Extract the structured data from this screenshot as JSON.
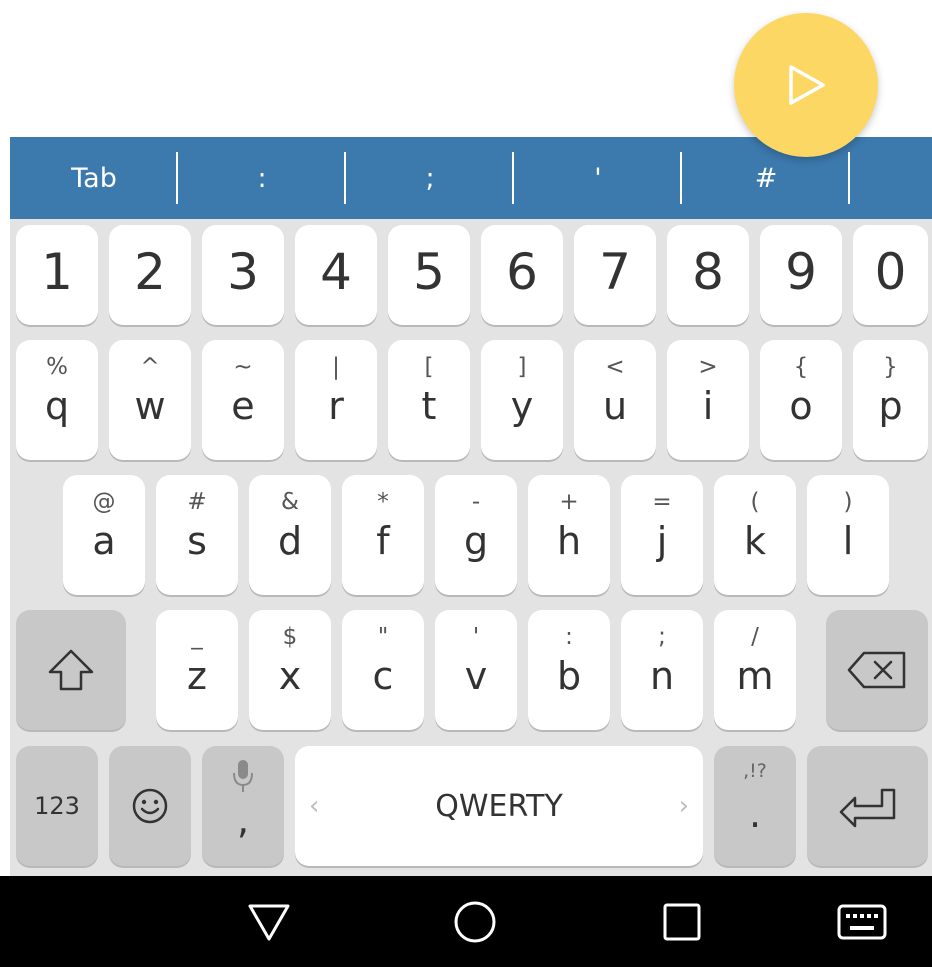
{
  "extra_row": {
    "keys": [
      "Tab",
      ":",
      ";",
      "'",
      "#",
      "("
    ]
  },
  "keyboard": {
    "numbers": [
      "1",
      "2",
      "3",
      "4",
      "5",
      "6",
      "7",
      "8",
      "9",
      "0"
    ],
    "row1": [
      {
        "main": "q",
        "sym": "%"
      },
      {
        "main": "w",
        "sym": "^"
      },
      {
        "main": "e",
        "sym": "~"
      },
      {
        "main": "r",
        "sym": "|"
      },
      {
        "main": "t",
        "sym": "["
      },
      {
        "main": "y",
        "sym": "]"
      },
      {
        "main": "u",
        "sym": "<"
      },
      {
        "main": "i",
        "sym": ">"
      },
      {
        "main": "o",
        "sym": "{"
      },
      {
        "main": "p",
        "sym": "}"
      }
    ],
    "row2": [
      {
        "main": "a",
        "sym": "@"
      },
      {
        "main": "s",
        "sym": "#"
      },
      {
        "main": "d",
        "sym": "&"
      },
      {
        "main": "f",
        "sym": "*"
      },
      {
        "main": "g",
        "sym": "-"
      },
      {
        "main": "h",
        "sym": "+"
      },
      {
        "main": "j",
        "sym": "="
      },
      {
        "main": "k",
        "sym": "("
      },
      {
        "main": "l",
        "sym": ")"
      }
    ],
    "row3": [
      {
        "main": "z",
        "sym": "_"
      },
      {
        "main": "x",
        "sym": "$"
      },
      {
        "main": "c",
        "sym": "\""
      },
      {
        "main": "v",
        "sym": "'"
      },
      {
        "main": "b",
        "sym": ":"
      },
      {
        "main": "n",
        "sym": ";"
      },
      {
        "main": "m",
        "sym": "/"
      }
    ],
    "bottom": {
      "numbers_label": "123",
      "comma_main": ",",
      "space_label": "QWERTY",
      "period_main": ".",
      "period_sym": ",!?"
    }
  },
  "colors": {
    "accent_bar": "#3c79ad",
    "fab": "#fdd764",
    "keyboard_bg": "#e3e3e3"
  },
  "icons": {
    "fab": "play-icon",
    "shift": "shift-icon",
    "backspace": "backspace-icon",
    "emoji": "emoji-icon",
    "mic": "mic-icon",
    "enter": "enter-icon",
    "nav_back": "back-triangle-icon",
    "nav_home": "home-circle-icon",
    "nav_recents": "recents-square-icon",
    "nav_keyboard": "keyboard-icon"
  }
}
